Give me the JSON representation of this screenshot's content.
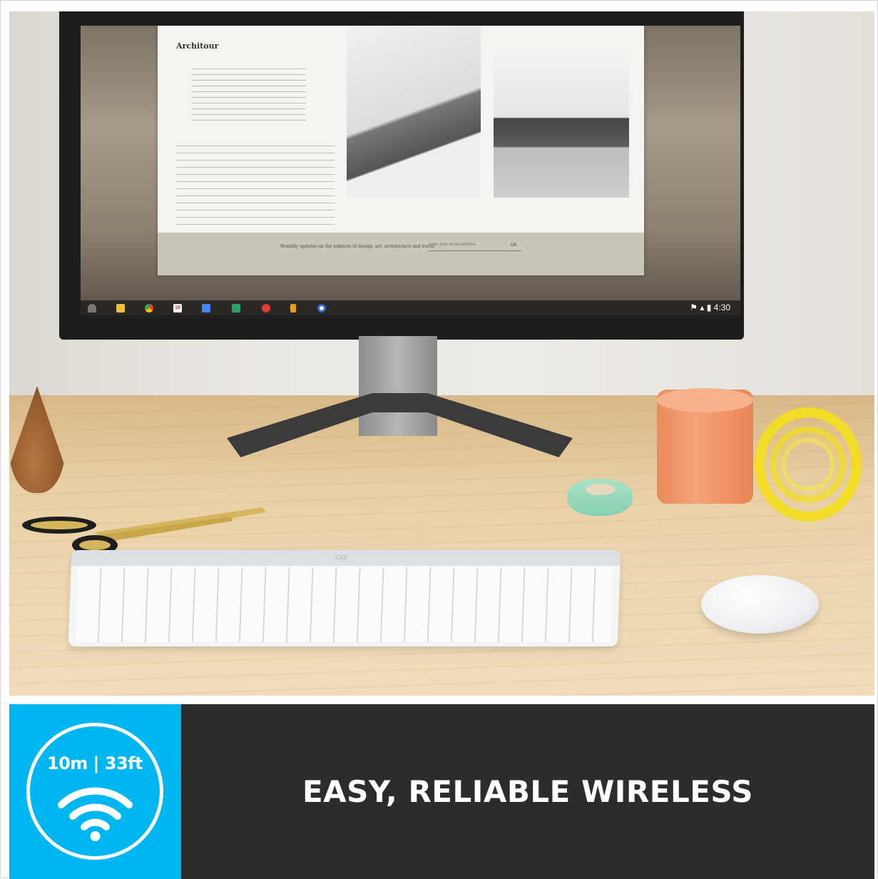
{
  "screen": {
    "article_title": "Architour",
    "newsletter_text": "Monthly updates on the subjects of design, art, architecture and travel",
    "newsletter_placeholder": "enter your email address",
    "newsletter_ok": "OK",
    "calendar_day": "18",
    "clock": "4:30"
  },
  "keyboard": {
    "brand": "logi"
  },
  "banner": {
    "range_text": "10m | 33ft",
    "headline": "EASY, RELIABLE WIRELESS",
    "accent_color": "#00b6f0",
    "background_color": "#2c2c2c",
    "icon": "wifi-icon"
  }
}
